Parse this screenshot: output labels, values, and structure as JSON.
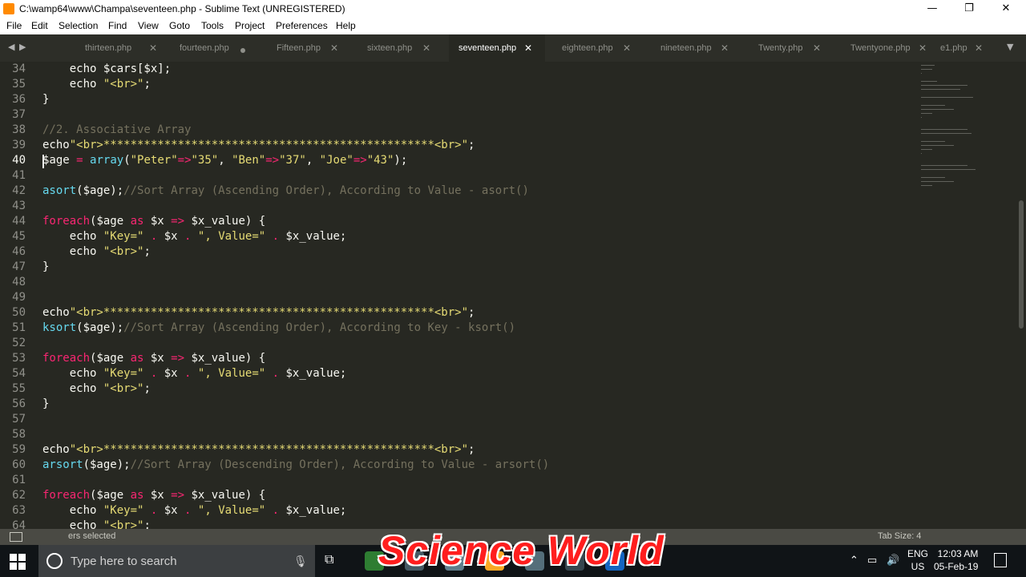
{
  "window": {
    "title": "C:\\wamp64\\www\\Champa\\seventeen.php - Sublime Text (UNREGISTERED)",
    "minimize": "—",
    "maximize": "❐",
    "close": "✕"
  },
  "menu": [
    "File",
    "Edit",
    "Selection",
    "Find",
    "View",
    "Goto",
    "Tools",
    "Project",
    "Preferences",
    "Help"
  ],
  "tabs": [
    {
      "label": "thirteen.php",
      "state": "close"
    },
    {
      "label": "fourteen.php",
      "state": "dirty"
    },
    {
      "label": "Fifteen.php",
      "state": "close"
    },
    {
      "label": "sixteen.php",
      "state": "close"
    },
    {
      "label": "seventeen.php",
      "state": "active"
    },
    {
      "label": "eighteen.php",
      "state": "close"
    },
    {
      "label": "nineteen.php",
      "state": "close"
    },
    {
      "label": "Twenty.php",
      "state": "close"
    },
    {
      "label": "Twentyone.php",
      "state": "close"
    },
    {
      "label": "e1.php",
      "state": "close"
    }
  ],
  "editor": {
    "current_line": 40,
    "lines": [
      {
        "n": 34,
        "tokens": [
          [
            "",
            "    echo $cars[$x];"
          ]
        ]
      },
      {
        "n": 35,
        "tokens": [
          [
            "",
            "    echo "
          ],
          [
            "str",
            "\"<br>\""
          ],
          [
            "",
            ";"
          ]
        ]
      },
      {
        "n": 36,
        "tokens": [
          [
            "",
            "}"
          ]
        ]
      },
      {
        "n": 37,
        "tokens": []
      },
      {
        "n": 38,
        "tokens": [
          [
            "cm",
            "//2. Associative Array"
          ]
        ]
      },
      {
        "n": 39,
        "tokens": [
          [
            "",
            "echo"
          ],
          [
            "str",
            "\"<br>*************************************************<br>\""
          ],
          [
            "",
            ";"
          ]
        ]
      },
      {
        "n": 40,
        "tokens": [
          [
            "",
            "$age "
          ],
          [
            "kw",
            "="
          ],
          [
            "",
            " "
          ],
          [
            "fn",
            "array"
          ],
          [
            "",
            "("
          ],
          [
            "str",
            "\"Peter\""
          ],
          [
            "kw",
            "=>"
          ],
          [
            "str",
            "\"35\""
          ],
          [
            "",
            ", "
          ],
          [
            "str",
            "\"Ben\""
          ],
          [
            "kw",
            "=>"
          ],
          [
            "str",
            "\"37\""
          ],
          [
            "",
            ", "
          ],
          [
            "str",
            "\"Joe\""
          ],
          [
            "kw",
            "=>"
          ],
          [
            "str",
            "\"43\""
          ],
          [
            "",
            ");"
          ]
        ]
      },
      {
        "n": 41,
        "tokens": []
      },
      {
        "n": 42,
        "tokens": [
          [
            "fn",
            "asort"
          ],
          [
            "",
            "($age);"
          ],
          [
            "cm",
            "//Sort Array (Ascending Order), According to Value - asort()"
          ]
        ]
      },
      {
        "n": 43,
        "tokens": []
      },
      {
        "n": 44,
        "tokens": [
          [
            "kw",
            "foreach"
          ],
          [
            "",
            "($age "
          ],
          [
            "kw",
            "as"
          ],
          [
            "",
            " $x "
          ],
          [
            "kw",
            "=>"
          ],
          [
            "",
            " $x_value) {"
          ]
        ]
      },
      {
        "n": 45,
        "tokens": [
          [
            "",
            "    echo "
          ],
          [
            "str",
            "\"Key=\""
          ],
          [
            "",
            " "
          ],
          [
            "kw",
            "."
          ],
          [
            "",
            " $x "
          ],
          [
            "kw",
            "."
          ],
          [
            "",
            " "
          ],
          [
            "str",
            "\", Value=\""
          ],
          [
            "",
            " "
          ],
          [
            "kw",
            "."
          ],
          [
            "",
            " $x_value;"
          ]
        ]
      },
      {
        "n": 46,
        "tokens": [
          [
            "",
            "    echo "
          ],
          [
            "str",
            "\"<br>\""
          ],
          [
            "",
            ";"
          ]
        ]
      },
      {
        "n": 47,
        "tokens": [
          [
            "",
            "}"
          ]
        ]
      },
      {
        "n": 48,
        "tokens": []
      },
      {
        "n": 49,
        "tokens": []
      },
      {
        "n": 50,
        "tokens": [
          [
            "",
            "echo"
          ],
          [
            "str",
            "\"<br>*************************************************<br>\""
          ],
          [
            "",
            ";"
          ]
        ]
      },
      {
        "n": 51,
        "tokens": [
          [
            "fn",
            "ksort"
          ],
          [
            "",
            "($age);"
          ],
          [
            "cm",
            "//Sort Array (Ascending Order), According to Key - ksort()"
          ]
        ]
      },
      {
        "n": 52,
        "tokens": []
      },
      {
        "n": 53,
        "tokens": [
          [
            "kw",
            "foreach"
          ],
          [
            "",
            "($age "
          ],
          [
            "kw",
            "as"
          ],
          [
            "",
            " $x "
          ],
          [
            "kw",
            "=>"
          ],
          [
            "",
            " $x_value) {"
          ]
        ]
      },
      {
        "n": 54,
        "tokens": [
          [
            "",
            "    echo "
          ],
          [
            "str",
            "\"Key=\""
          ],
          [
            "",
            " "
          ],
          [
            "kw",
            "."
          ],
          [
            "",
            " $x "
          ],
          [
            "kw",
            "."
          ],
          [
            "",
            " "
          ],
          [
            "str",
            "\", Value=\""
          ],
          [
            "",
            " "
          ],
          [
            "kw",
            "."
          ],
          [
            "",
            " $x_value;"
          ]
        ]
      },
      {
        "n": 55,
        "tokens": [
          [
            "",
            "    echo "
          ],
          [
            "str",
            "\"<br>\""
          ],
          [
            "",
            ";"
          ]
        ]
      },
      {
        "n": 56,
        "tokens": [
          [
            "",
            "}"
          ]
        ]
      },
      {
        "n": 57,
        "tokens": []
      },
      {
        "n": 58,
        "tokens": []
      },
      {
        "n": 59,
        "tokens": [
          [
            "",
            "echo"
          ],
          [
            "str",
            "\"<br>*************************************************<br>\""
          ],
          [
            "",
            ";"
          ]
        ]
      },
      {
        "n": 60,
        "tokens": [
          [
            "fn",
            "arsort"
          ],
          [
            "",
            "($age);"
          ],
          [
            "cm",
            "//Sort Array (Descending Order), According to Value - arsort()"
          ]
        ]
      },
      {
        "n": 61,
        "tokens": []
      },
      {
        "n": 62,
        "tokens": [
          [
            "kw",
            "foreach"
          ],
          [
            "",
            "($age "
          ],
          [
            "kw",
            "as"
          ],
          [
            "",
            " $x "
          ],
          [
            "kw",
            "=>"
          ],
          [
            "",
            " $x_value) {"
          ]
        ]
      },
      {
        "n": 63,
        "tokens": [
          [
            "",
            "    echo "
          ],
          [
            "str",
            "\"Key=\""
          ],
          [
            "",
            " "
          ],
          [
            "kw",
            "."
          ],
          [
            "",
            " $x "
          ],
          [
            "kw",
            "."
          ],
          [
            "",
            " "
          ],
          [
            "str",
            "\", Value=\""
          ],
          [
            "",
            " "
          ],
          [
            "kw",
            "."
          ],
          [
            "",
            " $x_value;"
          ]
        ]
      },
      {
        "n": 64,
        "tokens": [
          [
            "",
            "    echo "
          ],
          [
            "str",
            "\"<br>\""
          ],
          [
            "",
            ";"
          ]
        ]
      }
    ]
  },
  "status": {
    "selection": "ers selected",
    "tab_size": "Tab Size: 4"
  },
  "taskbar": {
    "search_placeholder": "Type here to search",
    "language_top": "ENG",
    "language_bottom": "US",
    "time": "12:03 AM",
    "date": "05-Feb-19"
  },
  "watermark": "Science World",
  "colors": {
    "editor_bg": "#272822",
    "keyword": "#f92672",
    "function": "#66d9ef",
    "string": "#e6db74",
    "comment": "#75715e",
    "text": "#f8f8f2"
  }
}
